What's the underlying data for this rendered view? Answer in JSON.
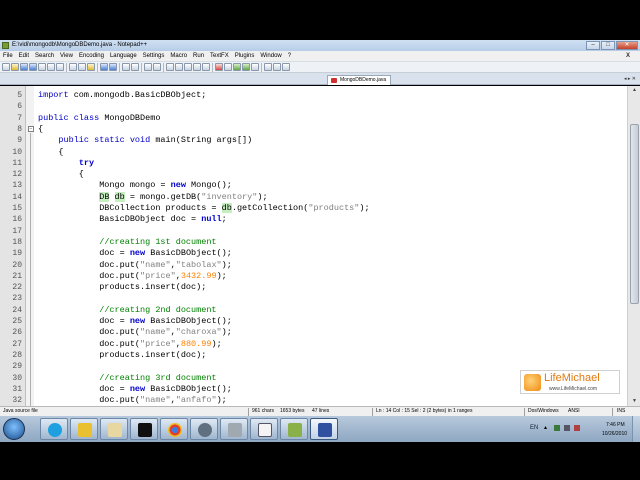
{
  "window": {
    "title": "E:\\vidi\\mongodb\\MongoDBDemo.java - Notepad++",
    "controls": {
      "minimize": "–",
      "maximize": "□",
      "close": "✕"
    }
  },
  "menu": {
    "items": [
      "File",
      "Edit",
      "Search",
      "View",
      "Encoding",
      "Language",
      "Settings",
      "Macro",
      "Run",
      "TextFX",
      "Plugins",
      "Window",
      "?"
    ],
    "close_glyph": "X"
  },
  "tab": {
    "label": "MongoDBDemo.java",
    "arrows": "◂ ▸ ✕"
  },
  "code_lines": [
    {
      "n": "5",
      "html": "<span class=\"kw\">import</span> com.mongodb.BasicDBObject;"
    },
    {
      "n": "6",
      "html": ""
    },
    {
      "n": "7",
      "html": "<span class=\"kw\">public class</span> MongoDBDemo"
    },
    {
      "n": "8",
      "html": "{"
    },
    {
      "n": "9",
      "html": "    <span class=\"kw\">public static void</span> main(String args[])"
    },
    {
      "n": "10",
      "html": "    {"
    },
    {
      "n": "11",
      "html": "        <span class=\"kwb\">try</span>"
    },
    {
      "n": "12",
      "html": "        {"
    },
    {
      "n": "13",
      "html": "            Mongo mongo = <span class=\"kwb\">new</span> Mongo();"
    },
    {
      "n": "14",
      "html": "            <span class=\"hl\">DB</span> <span class=\"hl\">db</span> = mongo.getDB(<span class=\"str\">\"inventory\"</span>);"
    },
    {
      "n": "15",
      "html": "            DBCollection products = <span class=\"hl\">db</span>.getCollection(<span class=\"str\">\"products\"</span>);"
    },
    {
      "n": "16",
      "html": "            BasicDBObject doc = <span class=\"kwb\">null</span>;"
    },
    {
      "n": "17",
      "html": ""
    },
    {
      "n": "18",
      "html": "            <span class=\"cm\">//creating 1st document</span>"
    },
    {
      "n": "19",
      "html": "            doc = <span class=\"kwb\">new</span> BasicDBObject();"
    },
    {
      "n": "20",
      "html": "            doc.put(<span class=\"str\">\"name\"</span>,<span class=\"str\">\"tabolax\"</span>);"
    },
    {
      "n": "21",
      "html": "            doc.put(<span class=\"str\">\"price\"</span>,<span class=\"num\">3432.99</span>);"
    },
    {
      "n": "22",
      "html": "            products.insert(doc);"
    },
    {
      "n": "23",
      "html": ""
    },
    {
      "n": "24",
      "html": "            <span class=\"cm\">//creating 2nd document</span>"
    },
    {
      "n": "25",
      "html": "            doc = <span class=\"kwb\">new</span> BasicDBObject();"
    },
    {
      "n": "26",
      "html": "            doc.put(<span class=\"str\">\"name\"</span>,<span class=\"str\">\"charoxa\"</span>);"
    },
    {
      "n": "27",
      "html": "            doc.put(<span class=\"str\">\"price\"</span>,<span class=\"num\">880.99</span>);"
    },
    {
      "n": "28",
      "html": "            products.insert(doc);"
    },
    {
      "n": "29",
      "html": ""
    },
    {
      "n": "30",
      "html": "            <span class=\"cm\">//creating 3rd document</span>"
    },
    {
      "n": "31",
      "html": "            doc = <span class=\"kwb\">new</span> BasicDBObject();"
    },
    {
      "n": "32",
      "html": "            doc.put(<span class=\"str\">\"name\"</span>,<span class=\"str\">\"anfafo\"</span>);"
    }
  ],
  "logo": {
    "name": "LifeMichael",
    "url": "www.LifeMichael.com"
  },
  "status": {
    "file_type": "Java source file",
    "chars": "961 chars",
    "bytes": "1653 bytes",
    "lines": "47 lines",
    "position": "Ln : 14   Col : 15   Sel : 2 (2 bytes) in 1 ranges",
    "eol": "Dos\\Windows",
    "encoding": "ANSI",
    "mode": "INS"
  },
  "taskbar": {
    "tray_lang": "EN",
    "clock_time": "7:46 PM",
    "clock_date": "10/26/2010"
  },
  "colors": {
    "keyword": "#0000cc",
    "string": "#808080",
    "number": "#ff8000",
    "comment": "#008000",
    "highlight": "#c6efc1",
    "logo_orange": "#e07a10"
  }
}
